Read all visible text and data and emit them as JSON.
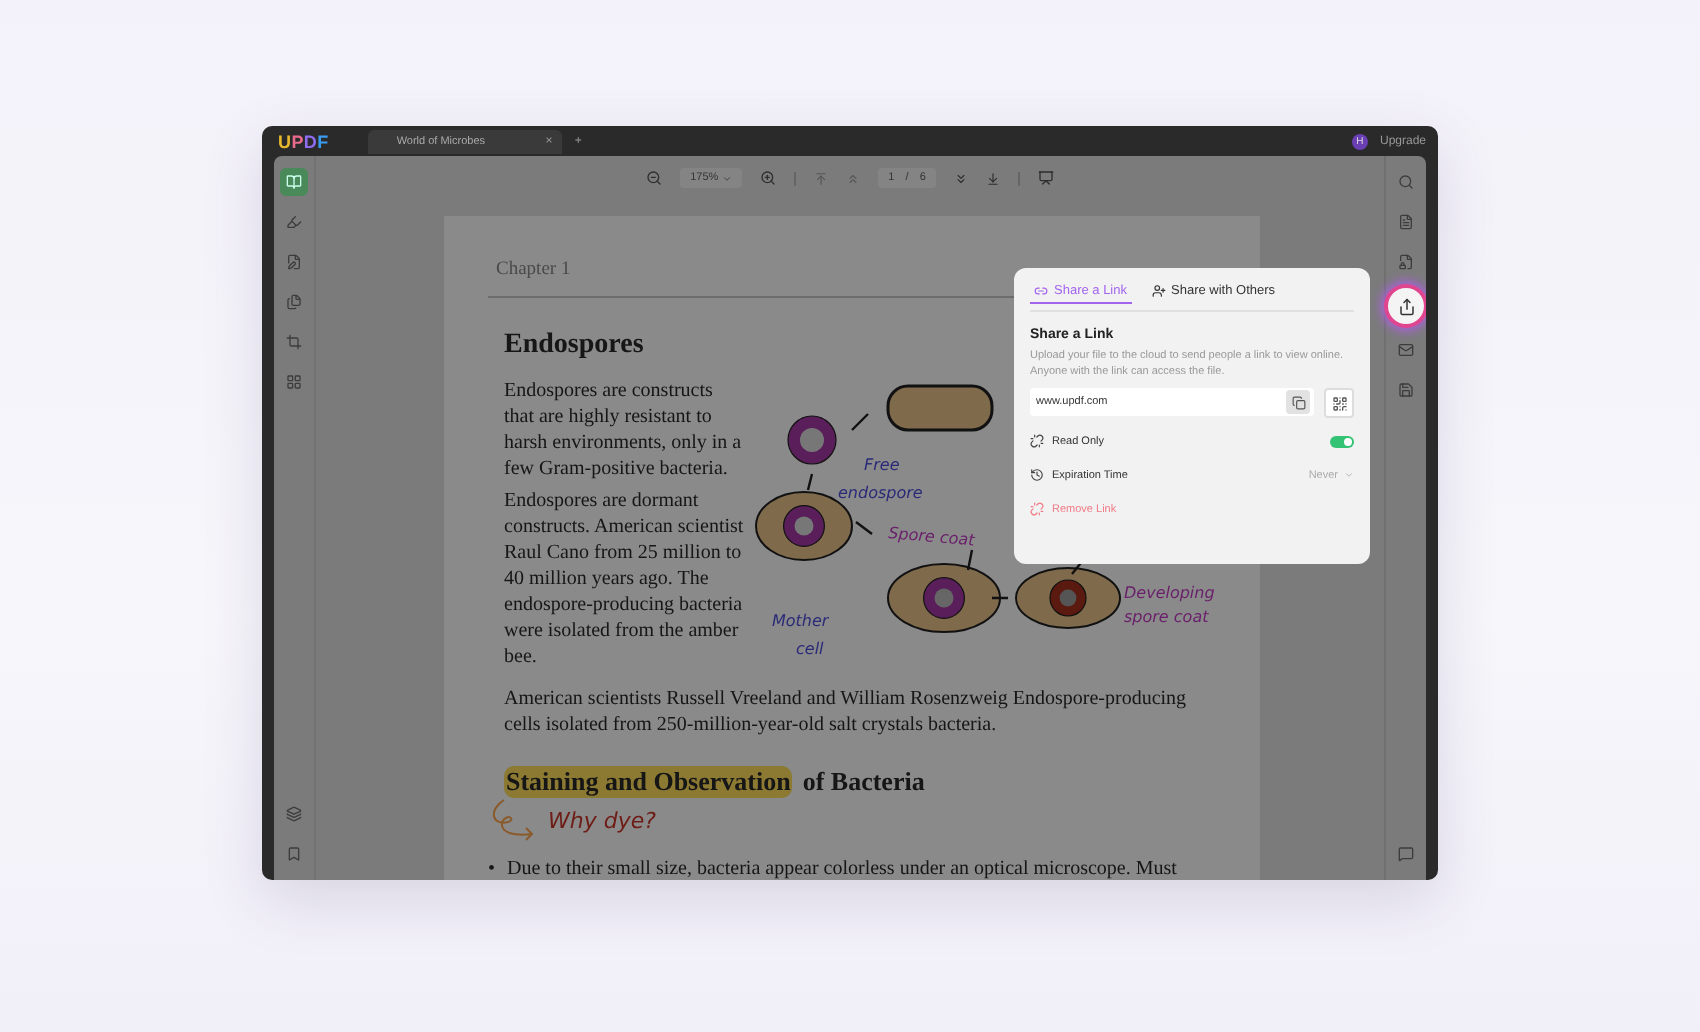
{
  "app": {
    "logo": "UPDF",
    "tabs": [
      {
        "title": "World of Microbes",
        "selected": true,
        "close": "×"
      }
    ],
    "new_tab": "+",
    "user_initial": "H",
    "upgrade": "Upgrade"
  },
  "left_tools": [
    {
      "kind": "reader",
      "selected": true
    },
    {
      "kind": "comment",
      "selected": false
    },
    {
      "kind": "edit",
      "selected": false
    },
    {
      "kind": "organize",
      "selected": false
    },
    {
      "kind": "crop",
      "selected": false
    },
    {
      "kind": "pages",
      "selected": false
    }
  ],
  "toolbar": {
    "zoom": "175%",
    "page": "1",
    "page_sep": "/",
    "page_total": "6"
  },
  "right_tools": [
    {
      "kind": "search",
      "selected": false
    },
    {
      "kind": "convert",
      "selected": false
    },
    {
      "kind": "protect",
      "selected": false
    },
    {
      "kind": "share",
      "selected": true
    },
    {
      "kind": "mail",
      "selected": false
    },
    {
      "kind": "save",
      "selected": false
    }
  ],
  "document": {
    "chapter": "Chapter 1",
    "heading": "Endospores",
    "column_paragraphs": [
      "Endospores are constructs that are highly resistant to harsh environments, only in a few Gram-positive bacteria.",
      "Endospores are dormant constructs. American scientist Raul Cano from 25 million to 40 million years ago. The endospore-producing bacteria were isolated from the amber bee."
    ],
    "figure_labels": [
      "Free",
      "endospore",
      "Spore coat",
      "Mother",
      "cell",
      "Developing",
      "spore coat"
    ],
    "paragraph": "American scientists Russell Vreeland and William Rosenzweig Endospore-producing cells isolated from 250-million-year-old salt crystals bacteria.",
    "heading2": [
      {
        "text": "Staining and Observation",
        "highlighted": true
      },
      {
        "text": "of Bacteria",
        "highlighted": false
      }
    ],
    "note": "Why dye?",
    "bullet_mark": "•",
    "bullets": [
      "Due to their small size, bacteria appear colorless under an optical microscope. Must"
    ]
  },
  "share_popup": {
    "tabs": [
      {
        "label": "Share a Link",
        "selected": true
      },
      {
        "label": "Share with Others",
        "selected": false
      }
    ],
    "title": "Share a Link",
    "description": "Upload your file to the cloud to send people a link to view online. Anyone with the link can access the file.",
    "url": "www.updf.com",
    "read_only": {
      "label": "Read Only",
      "on": true
    },
    "expiration": {
      "label": "Expiration Time",
      "value": "Never"
    },
    "remove": "Remove Link"
  }
}
